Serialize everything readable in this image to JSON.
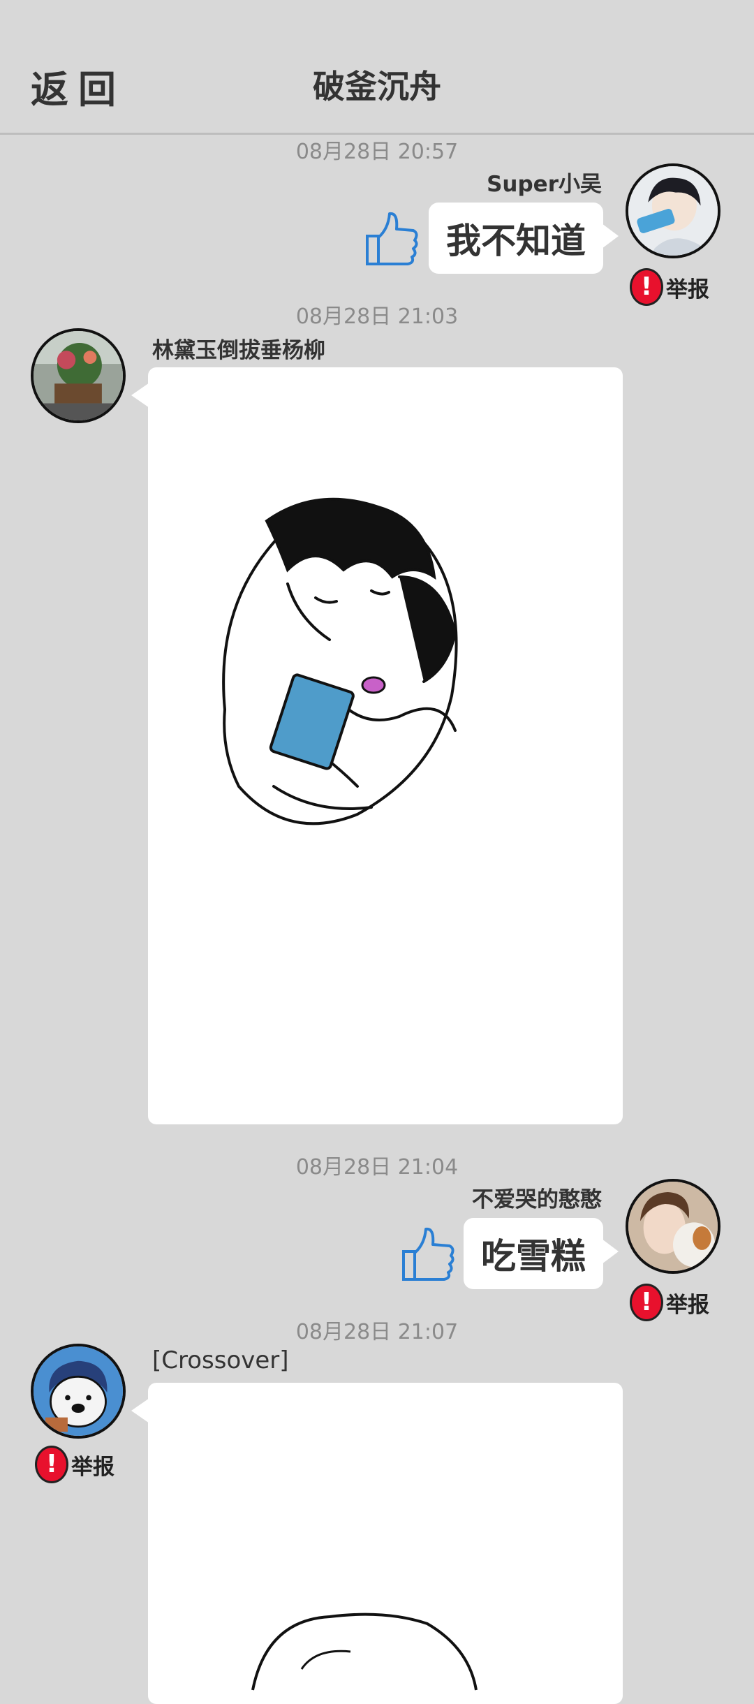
{
  "header": {
    "back_label": "返回",
    "title": "破釜沉舟"
  },
  "messages": [
    {
      "time": "08月28日  20:57",
      "sender": "Super小吴",
      "text": "我不知道",
      "report_label": "举报",
      "avatar_icon": "anime-boy-popsicle-avatar"
    },
    {
      "time": "08月28日  21:03",
      "sender": "林黛玉倒拔垂杨柳",
      "image": "sketch-girl-eating-popsicle",
      "avatar_icon": "flower-cart-photo-avatar"
    },
    {
      "time": "08月28日  21:04",
      "sender": "不爱哭的憨憨",
      "text": "吃雪糕",
      "report_label": "举报",
      "avatar_icon": "girl-with-dog-photo-avatar"
    },
    {
      "time": "08月28日  21:07",
      "sender": "[Crossover]",
      "image": "sketch-drawing",
      "report_label": "举报",
      "avatar_icon": "polar-bear-cartoon-avatar"
    }
  ],
  "colors": {
    "background": "#d8d8d8",
    "bubble": "#ffffff",
    "report_red": "#e8112d",
    "thumb_blue": "#2a7fd4"
  },
  "icons": {
    "like": "thumbs-up-icon",
    "report": "exclamation-icon"
  }
}
